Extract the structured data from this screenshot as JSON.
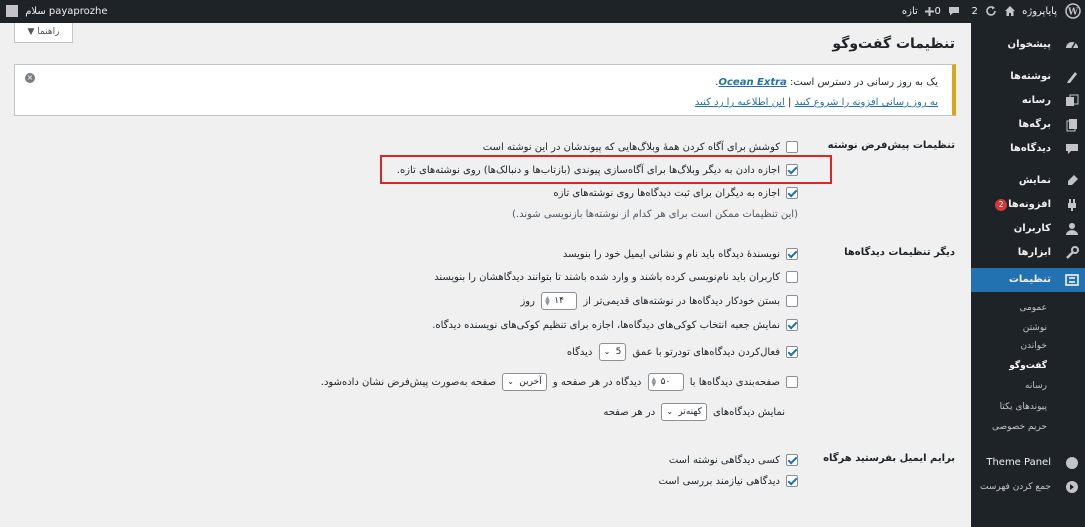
{
  "adminbar": {
    "site_name": "پایاپروژه",
    "updates_count": "2",
    "comments_count": "0",
    "new_label": "تازه",
    "greeting": "سلام payaprozhe"
  },
  "sidebar": {
    "items": [
      {
        "label": "پیشخوان",
        "icon": "dashboard-icon"
      },
      {
        "label": "نوشته‌ها",
        "icon": "posts-icon"
      },
      {
        "label": "رسانه",
        "icon": "media-icon"
      },
      {
        "label": "برگه‌ها",
        "icon": "pages-icon"
      },
      {
        "label": "دیدگاه‌ها",
        "icon": "comments-icon"
      },
      {
        "label": "نمایش",
        "icon": "appearance-icon"
      },
      {
        "label": "افزونه‌ها",
        "icon": "plugins-icon",
        "badge": "2"
      },
      {
        "label": "کاربران",
        "icon": "users-icon"
      },
      {
        "label": "ابزارها",
        "icon": "tools-icon"
      },
      {
        "label": "تنظیمات",
        "icon": "settings-icon"
      }
    ],
    "submenu": [
      "عمومی",
      "نوشتن",
      "خواندن",
      "گفت‌وگو",
      "رسانه",
      "پیوندهای یکتا",
      "حریم خصوصی"
    ],
    "theme_panel": "Theme Panel",
    "collapse": "جمع کردن فهرست"
  },
  "help_tab": "راهنما",
  "page_title": "تنظیمات گفت‌وگو",
  "notice": {
    "text_before": "یک به روز رسانی در دسترس است: ",
    "plugin_name": "Ocean Extra",
    "link_start": "به روز رسانی افزونه را شروع کنید",
    "separator": " | ",
    "link_dismiss": "این اطلاعیه را رد کنید"
  },
  "sections": {
    "default_post": {
      "title": "تنظیمات پیش‌فرض نوشته",
      "opt1": "کوشش برای آگاه کردن همهٔ وبلاگ‌هایی که پیوندشان در این نوشته است",
      "opt2": "اجازه دادن به دیگر وبلاگ‌ها برای آگاه‌سازی پیوندی (بازتاب‌ها و دنبالک‌ها) روی نوشته‌های تازه.",
      "opt3": "اجازه به دیگران برای ثبت دیدگاه‌ها روی نوشته‌های تازه",
      "note": "(این تنظیمات ممکن است برای هر کدام از نوشته‌ها بازنویسی شوند.)"
    },
    "other_comments": {
      "title": "دیگر تنظیمات دیدگاه‌ها",
      "opt1": "نویسندهٔ دیدگاه باید نام و نشانی ایمیل خود را بنویسد",
      "opt2": "کاربران باید نام‌نویسی کرده باشند و وارد شده باشند تا بتوانند دیدگاهشان را بنویسند",
      "opt3_before": "بستن خودکار دیدگاه‌ها در نوشته‌های قدیمی‌تر از",
      "opt3_value": "۱۴",
      "opt3_after": "روز",
      "opt4": "نمایش جعبه انتخاب کوکی‌های دیدگاه‌ها، اجازه برای تنظیم کوکی‌های نویسنده دیدگاه.",
      "opt5_before": "فعال‌کردن دیدگاه‌های تودرتو با عمق",
      "opt5_value": "5",
      "opt5_after": "دیدگاه",
      "opt6_before": "صفحه‌بندی دیدگاه‌ها با",
      "opt6_value": "۵۰",
      "opt6_mid": "دیدگاه در هر صفحه و",
      "opt6_select": "آخرین",
      "opt6_after": "صفحه به‌صورت پیش‌فرض نشان داده‌شود.",
      "opt7_before": "نمایش دیدگاه‌های",
      "opt7_select": "کهنه‌تر",
      "opt7_after": "در هر صفحه"
    },
    "email": {
      "title": "برایم ایمیل بفرستید هرگاه",
      "opt1": "کسی دیدگاهی نوشته است",
      "opt2": "دیدگاهی نیازمند بررسی است"
    }
  }
}
